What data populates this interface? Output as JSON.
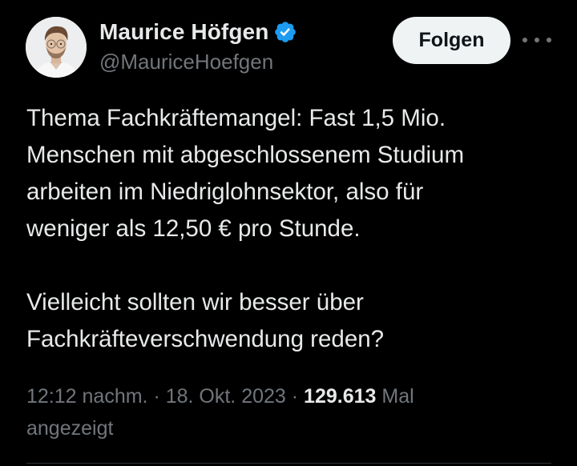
{
  "author": {
    "display_name": "Maurice Höfgen",
    "handle": "@MauriceHoefgen",
    "verified_badge_color": "#1d9bf0"
  },
  "actions": {
    "follow_label": "Folgen",
    "more_icon": "more-horizontal-icon"
  },
  "tweet": {
    "paragraph_1": "Thema Fachkräftemangel: Fast 1,5 Mio.\nMenschen mit abgeschlossenem Studium\narbeiten im Niedriglohnsektor, also für\nweniger als 12,50 € pro Stunde.",
    "paragraph_2": "Vielleicht sollten wir besser über\nFachkräfteverschwendung reden?"
  },
  "meta": {
    "time": "12:12 nachm.",
    "separator": " · ",
    "date": "18. Okt. 2023",
    "views_count": "129.613",
    "views_label_line1": " Mal",
    "views_label_line2": "angezeigt"
  },
  "colors": {
    "background": "#000000",
    "text_primary": "#e7e9ea",
    "text_secondary": "#71767b",
    "follow_bg": "#eff3f4"
  }
}
